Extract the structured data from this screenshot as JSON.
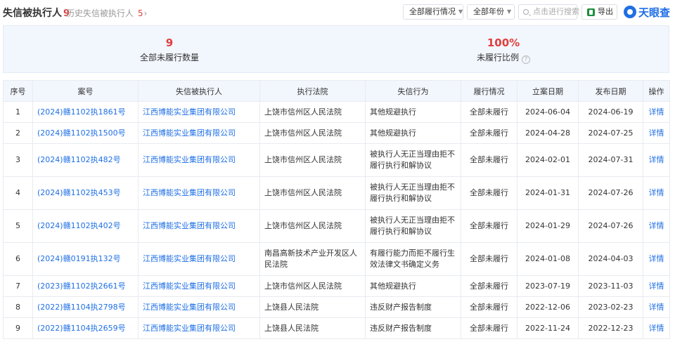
{
  "header": {
    "title": "失信被执行人",
    "title_count": "9",
    "history_label": "历史失信被执行人",
    "history_count": "5",
    "history_arrow": "›",
    "filter_performance": "全部履行情况",
    "filter_year": "全部年份",
    "search_placeholder": "点击进行搜索",
    "export_label": "导出",
    "logo_text": "天眼查"
  },
  "summary": {
    "unfulfilled_count": "9",
    "unfulfilled_count_label": "全部未履行数量",
    "unfulfilled_ratio": "100%",
    "unfulfilled_ratio_label": "未履行比例",
    "help_glyph": "?"
  },
  "table": {
    "headers": [
      "序号",
      "案号",
      "失信被执行人",
      "执行法院",
      "失信行为",
      "履行情况",
      "立案日期",
      "发布日期",
      "操作"
    ],
    "rows": [
      {
        "no": "1",
        "case": "(2024)赣1102执1861号",
        "party": "江西博能实业集团有限公司",
        "court": "上饶市信州区人民法院",
        "behavior": "其他规避执行",
        "status": "全部未履行",
        "filed": "2024-06-04",
        "published": "2024-06-19",
        "action": "详情"
      },
      {
        "no": "2",
        "case": "(2024)赣1102执1500号",
        "party": "江西博能实业集团有限公司",
        "court": "上饶市信州区人民法院",
        "behavior": "其他规避执行",
        "status": "全部未履行",
        "filed": "2024-04-28",
        "published": "2024-07-25",
        "action": "详情"
      },
      {
        "no": "3",
        "case": "(2024)赣1102执482号",
        "party": "江西博能实业集团有限公司",
        "court": "上饶市信州区人民法院",
        "behavior": "被执行人无正当理由拒不履行执行和解协议",
        "status": "全部未履行",
        "filed": "2024-02-01",
        "published": "2024-07-31",
        "action": "详情"
      },
      {
        "no": "4",
        "case": "(2024)赣1102执453号",
        "party": "江西博能实业集团有限公司",
        "court": "上饶市信州区人民法院",
        "behavior": "被执行人无正当理由拒不履行执行和解协议",
        "status": "全部未履行",
        "filed": "2024-01-31",
        "published": "2024-07-26",
        "action": "详情"
      },
      {
        "no": "5",
        "case": "(2024)赣1102执402号",
        "party": "江西博能实业集团有限公司",
        "court": "上饶市信州区人民法院",
        "behavior": "被执行人无正当理由拒不履行执行和解协议",
        "status": "全部未履行",
        "filed": "2024-01-29",
        "published": "2024-07-26",
        "action": "详情"
      },
      {
        "no": "6",
        "case": "(2024)赣0191执132号",
        "party": "江西博能实业集团有限公司",
        "court": "南昌高新技术产业开发区人民法院",
        "behavior": "有履行能力而拒不履行生效法律文书确定义务",
        "status": "全部未履行",
        "filed": "2024-01-08",
        "published": "2024-04-03",
        "action": "详情"
      },
      {
        "no": "7",
        "case": "(2023)赣1102执2661号",
        "party": "江西博能实业集团有限公司",
        "court": "上饶市信州区人民法院",
        "behavior": "其他规避执行",
        "status": "全部未履行",
        "filed": "2023-07-19",
        "published": "2023-11-03",
        "action": "详情"
      },
      {
        "no": "8",
        "case": "(2022)赣1104执2798号",
        "party": "江西博能实业集团有限公司",
        "court": "上饶县人民法院",
        "behavior": "违反财产报告制度",
        "status": "全部未履行",
        "filed": "2022-12-06",
        "published": "2023-02-23",
        "action": "详情"
      },
      {
        "no": "9",
        "case": "(2022)赣1104执2659号",
        "party": "江西博能实业集团有限公司",
        "court": "上饶县人民法院",
        "behavior": "违反财产报告制度",
        "status": "全部未履行",
        "filed": "2022-11-24",
        "published": "2022-12-23",
        "action": "详情"
      }
    ]
  }
}
